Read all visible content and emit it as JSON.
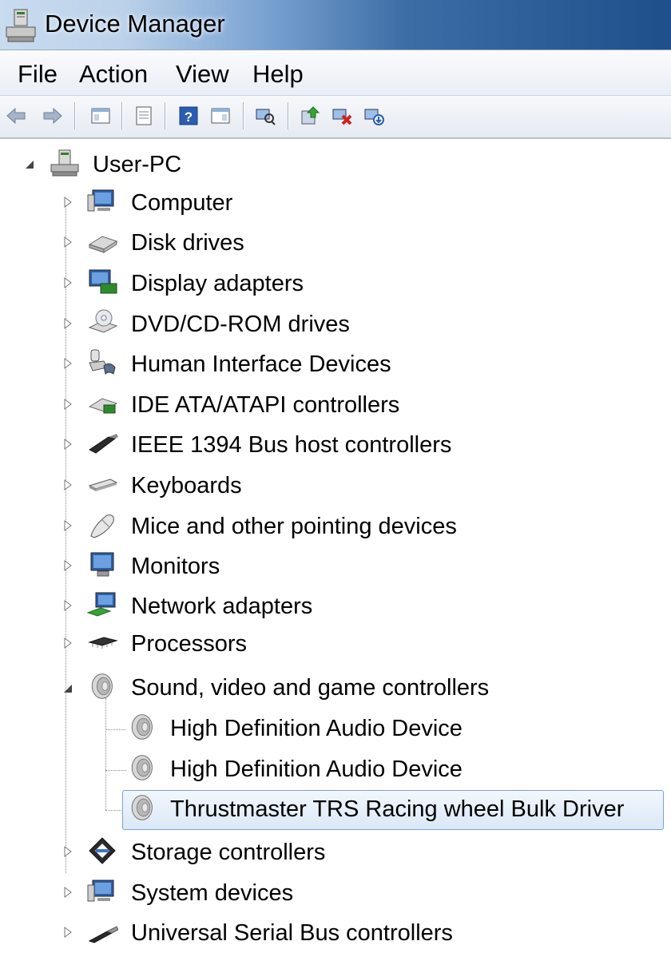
{
  "window": {
    "title": "Device Manager",
    "icon": "device-manager-icon"
  },
  "menu": [
    "File",
    "Action",
    "View",
    "Help"
  ],
  "toolbar": [
    "back-arrow-icon",
    "forward-arrow-icon",
    "show-hide-console-tree-icon",
    "properties-icon",
    "help-icon",
    "show-action-pane-icon",
    "scan-hardware-icon",
    "update-driver-icon",
    "uninstall-icon",
    "disable-device-icon"
  ],
  "tree": {
    "root": {
      "label": "User-PC",
      "expanded": true,
      "icon": "computer-tower-icon"
    },
    "categories": [
      {
        "label": "Computer",
        "icon": "computer-icon",
        "expanded": false
      },
      {
        "label": "Disk drives",
        "icon": "disk-drive-icon",
        "expanded": false
      },
      {
        "label": "Display adapters",
        "icon": "display-adapter-icon",
        "expanded": false
      },
      {
        "label": "DVD/CD-ROM drives",
        "icon": "dvd-drive-icon",
        "expanded": false
      },
      {
        "label": "Human Interface Devices",
        "icon": "hid-icon",
        "expanded": false
      },
      {
        "label": "IDE ATA/ATAPI controllers",
        "icon": "ide-controller-icon",
        "expanded": false
      },
      {
        "label": "IEEE 1394 Bus host controllers",
        "icon": "firewire-icon",
        "expanded": false
      },
      {
        "label": "Keyboards",
        "icon": "keyboard-icon",
        "expanded": false
      },
      {
        "label": "Mice and other pointing devices",
        "icon": "mouse-icon",
        "expanded": false
      },
      {
        "label": "Monitors",
        "icon": "monitor-icon",
        "expanded": false
      },
      {
        "label": "Network adapters",
        "icon": "network-adapter-icon",
        "expanded": false
      },
      {
        "label": "Processors",
        "icon": "processor-icon",
        "expanded": false
      },
      {
        "label": "Sound, video and game controllers",
        "icon": "speaker-icon",
        "expanded": true,
        "children": [
          {
            "label": "High Definition Audio Device",
            "icon": "speaker-icon"
          },
          {
            "label": "High Definition Audio Device",
            "icon": "speaker-icon"
          },
          {
            "label": "Thrustmaster TRS Racing wheel Bulk Driver",
            "icon": "speaker-icon",
            "selected": true
          }
        ]
      },
      {
        "label": "Storage controllers",
        "icon": "storage-controller-icon",
        "expanded": false
      },
      {
        "label": "System devices",
        "icon": "system-devices-icon",
        "expanded": false
      },
      {
        "label": "Universal Serial Bus controllers",
        "icon": "usb-icon",
        "expanded": false
      }
    ]
  },
  "colors": {
    "selection_border": "#7da2ce",
    "selection_fill": "#dbe8f7",
    "title_bar_dark": "#1f4f8a"
  }
}
